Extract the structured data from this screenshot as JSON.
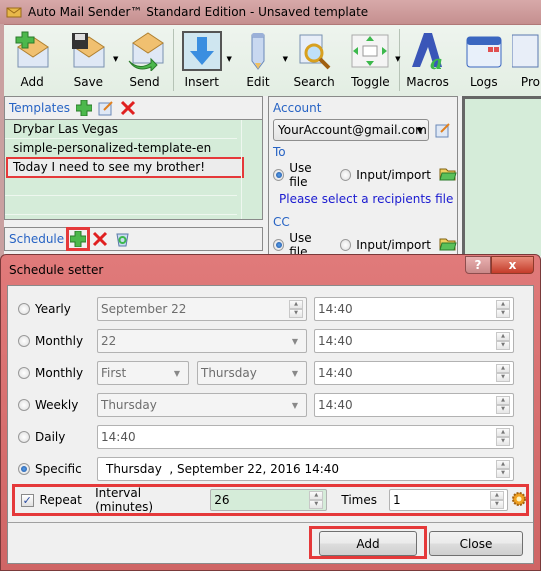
{
  "window": {
    "title": "Auto Mail Sender™ Standard Edition - Unsaved template"
  },
  "toolbar": {
    "buttons": [
      {
        "label": "Add",
        "icon": "add-envelope-icon"
      },
      {
        "label": "Save",
        "icon": "save-envelope-icon"
      },
      {
        "label": "Send",
        "icon": "send-envelope-icon"
      },
      {
        "label": "Insert",
        "icon": "insert-arrow-icon"
      },
      {
        "label": "Edit",
        "icon": "pencil-icon"
      },
      {
        "label": "Search",
        "icon": "search-icon"
      },
      {
        "label": "Toggle",
        "icon": "toggle-icon"
      },
      {
        "label": "Macros",
        "icon": "macros-icon"
      },
      {
        "label": "Logs",
        "icon": "calendar-icon"
      },
      {
        "label": "Pro",
        "icon": "document-icon"
      }
    ]
  },
  "templates": {
    "header": "Templates",
    "items": [
      "Drybar Las Vegas",
      "simple-personalized-template-en",
      "Today I need to see my brother!"
    ],
    "selected_index": 2
  },
  "schedule": {
    "header": "Schedule"
  },
  "account": {
    "label": "Account",
    "value": "YourAccount@gmail.com",
    "to_label": "To",
    "use_file": "Use file",
    "input_import": "Input/import",
    "recipients_note": "Please select a recipients file",
    "cc_label": "CC"
  },
  "dialog": {
    "title": "Schedule setter",
    "help": "?",
    "close": "x",
    "rows": {
      "yearly": {
        "label": "Yearly",
        "date": "September 22",
        "time": "14:40"
      },
      "monthly1": {
        "label": "Monthly",
        "day": "22",
        "time": "14:40"
      },
      "monthly2": {
        "label": "Monthly",
        "week": "First",
        "weekday": "Thursday",
        "time": "14:40"
      },
      "weekly": {
        "label": "Weekly",
        "weekday": "Thursday",
        "time": "14:40"
      },
      "daily": {
        "label": "Daily",
        "time": "14:40"
      },
      "specific": {
        "label": "Specific",
        "datetime": "Thursday  , September 22, 2016 14:40"
      }
    },
    "selected": "specific",
    "repeat": {
      "label": "Repeat",
      "checked": true,
      "interval_label": "Interval (minutes)",
      "interval_value": "26",
      "times_label": "Times",
      "times_value": "1"
    },
    "add_label": "Add",
    "close_label": "Close"
  }
}
